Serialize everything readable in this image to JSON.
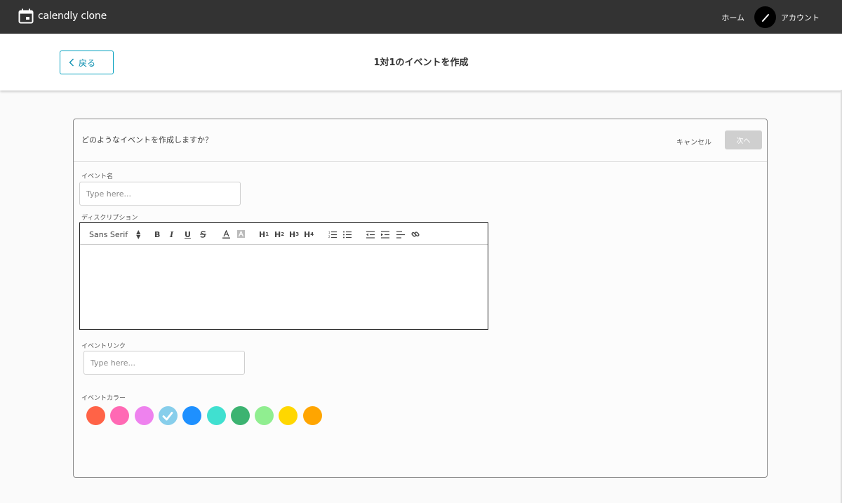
{
  "app": {
    "name": "calendly clone",
    "icon": "calendar-icon"
  },
  "nav": {
    "home_label": "ホーム",
    "account_label": "アカウント",
    "avatar_icon": "pen-icon"
  },
  "subheader": {
    "back_label": "戻る",
    "title": "1対1のイベントを作成"
  },
  "card": {
    "question": "どのようなイベントを作成しますか？",
    "cancel_label": "キャンセル",
    "next_label": "次へ"
  },
  "form": {
    "event_name": {
      "label": "イベント名",
      "placeholder": "Type here...",
      "value": ""
    },
    "description": {
      "label": "ディスクリプション",
      "font_select": "Sans Serif",
      "toolbar": {
        "bold": "B",
        "italic": "I",
        "underline": "U",
        "strike": "S",
        "h1": "H",
        "h2": "H",
        "h3": "H",
        "h4": "H",
        "h1_sub": "1",
        "h2_sub": "2",
        "h3_sub": "3",
        "h4_sub": "4"
      }
    },
    "event_link": {
      "label": "イベントリンク",
      "placeholder": "Type here...",
      "value": ""
    },
    "event_color": {
      "label": "イベントカラー",
      "selected_index": 3,
      "colors": [
        "#ff6347",
        "#ff69b4",
        "#ee82ee",
        "#87ceeb",
        "#1e90ff",
        "#40e0d0",
        "#3cb371",
        "#90ee90",
        "#ffd700",
        "#ffa500"
      ]
    }
  },
  "colors": {
    "appbar": "#333333",
    "accent": "#0aa2c0",
    "next_disabled": "#cfcfcf"
  }
}
